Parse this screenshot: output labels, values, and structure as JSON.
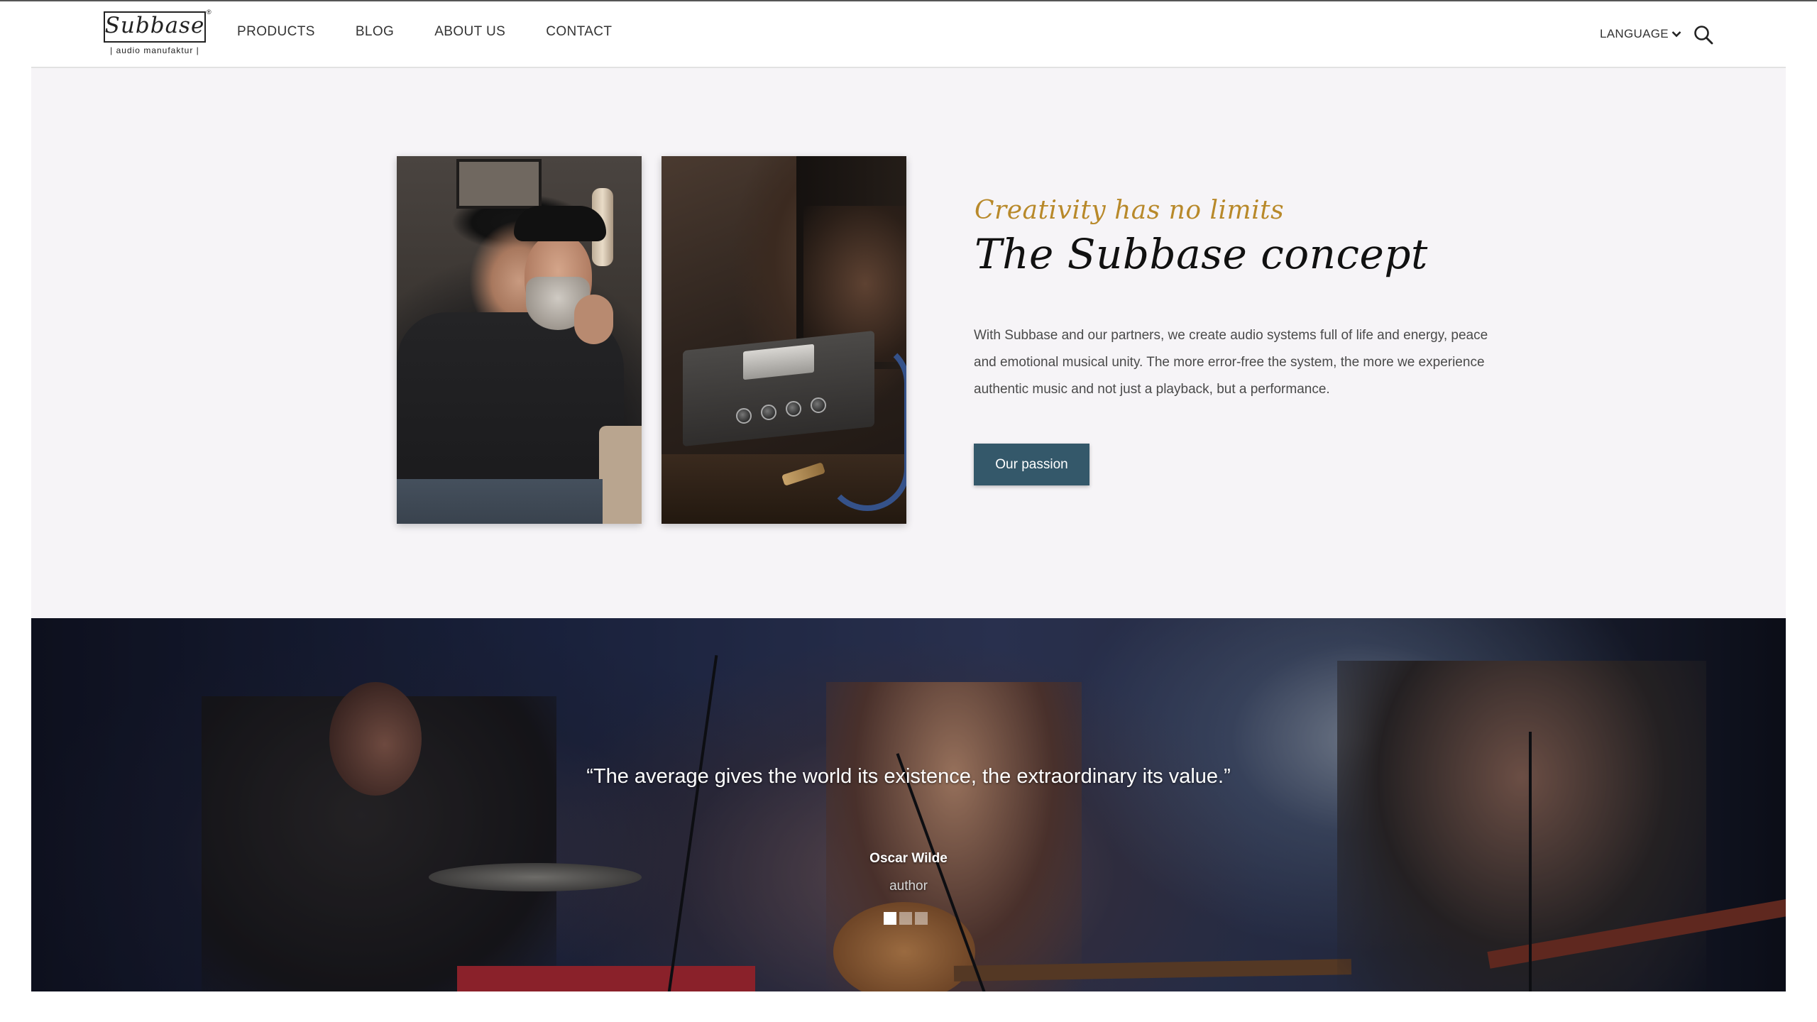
{
  "header": {
    "logo": {
      "script": "Subbase",
      "registered": "®",
      "subtitle": "| audio manufaktur |"
    },
    "nav": [
      "PRODUCTS",
      "BLOG",
      "ABOUT US",
      "CONTACT"
    ],
    "language_label": "LANGUAGE",
    "icons": {
      "language": "chevron-down-icon",
      "search": "search-icon"
    }
  },
  "concept": {
    "tagline": "Creativity has no limits",
    "headline": "The Subbase concept",
    "body": "With Subbase and our partners, we create audio systems full of life and energy, peace and emotional musical unity. The more error-free the system, the more we experience authentic music and not just a playback, but a performance.",
    "cta_label": "Our passion"
  },
  "testimonial": {
    "quote": "“The average gives the world its existence, the extraordinary its value.”",
    "author": "Oscar Wilde",
    "role": "author",
    "slides": 3,
    "active_slide": 1
  },
  "colors": {
    "accent_gold": "#b8892a",
    "button_teal": "#34586a",
    "section_bg": "#f6f4f7"
  }
}
